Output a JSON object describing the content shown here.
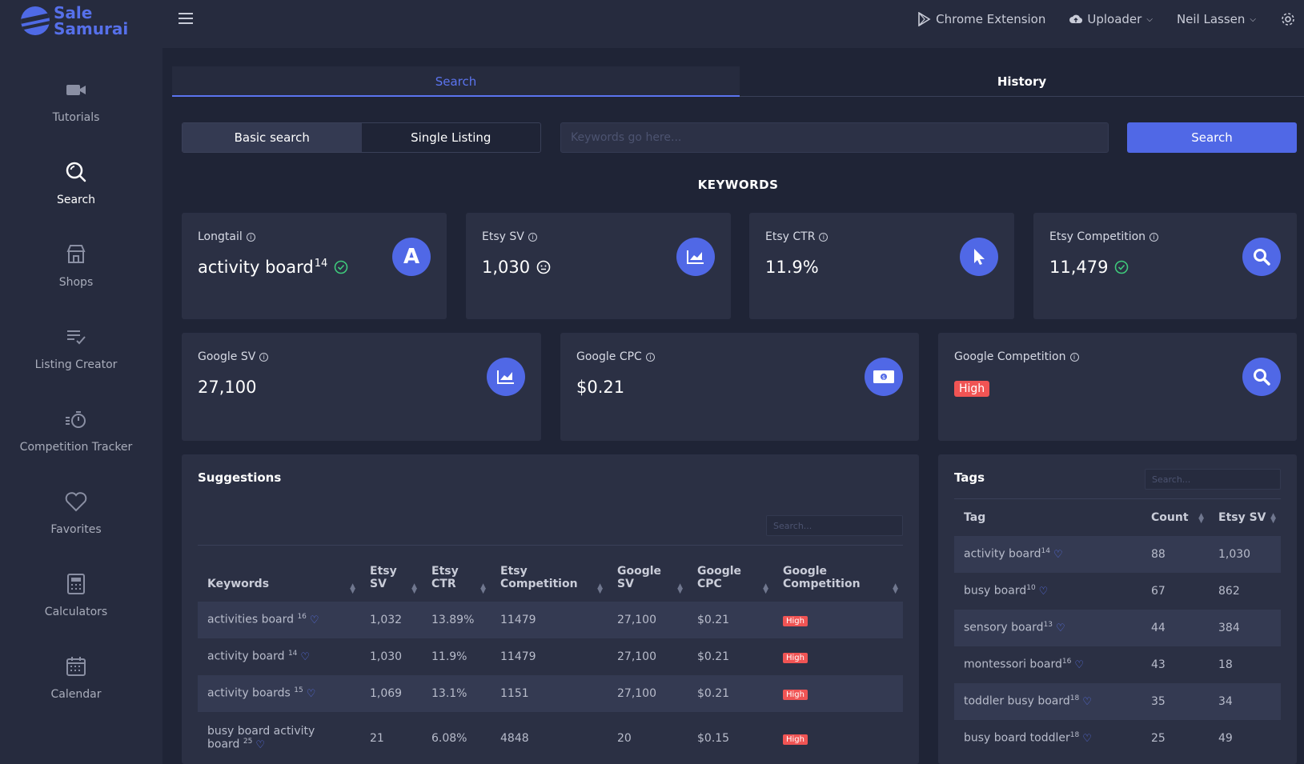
{
  "brand": {
    "line1": "Sale",
    "line2": "Samurai"
  },
  "nav": [
    {
      "label": "Tutorials",
      "icon": "video-camera-icon"
    },
    {
      "label": "Search",
      "icon": "search-icon",
      "active": true
    },
    {
      "label": "Shops",
      "icon": "shop-icon"
    },
    {
      "label": "Listing Creator",
      "icon": "list-check-icon"
    },
    {
      "label": "Competition Tracker",
      "icon": "stopwatch-icon"
    },
    {
      "label": "Favorites",
      "icon": "heart-icon"
    },
    {
      "label": "Calculators",
      "icon": "calculator-icon"
    },
    {
      "label": "Calendar",
      "icon": "calendar-icon"
    }
  ],
  "topbar": {
    "chrome_extension": "Chrome Extension",
    "uploader": "Uploader",
    "user": "Neil Lassen"
  },
  "tabs": {
    "search": "Search",
    "history": "History"
  },
  "search_mode": {
    "basic": "Basic search",
    "single": "Single Listing"
  },
  "keyword_input": {
    "placeholder": "Keywords go here..."
  },
  "search_button": "Search",
  "section_title": "KEYWORDS",
  "cards": {
    "longtail": {
      "label": "Longtail",
      "value": "activity board",
      "sup": "14"
    },
    "etsy_sv": {
      "label": "Etsy SV",
      "value": "1,030"
    },
    "etsy_ctr": {
      "label": "Etsy CTR",
      "value": "11.9%"
    },
    "etsy_competition": {
      "label": "Etsy Competition",
      "value": "11,479"
    },
    "google_sv": {
      "label": "Google SV",
      "value": "27,100"
    },
    "google_cpc": {
      "label": "Google CPC",
      "value": "$0.21"
    },
    "google_competition": {
      "label": "Google Competition",
      "value": "High"
    }
  },
  "suggestions": {
    "title": "Suggestions",
    "search_placeholder": "Search...",
    "headers": {
      "keywords": "Keywords",
      "etsy_sv_1": "Etsy",
      "etsy_sv_2": "SV",
      "etsy_ctr_1": "Etsy",
      "etsy_ctr_2": "CTR",
      "etsy_comp_1": "Etsy",
      "etsy_comp_2": "Competition",
      "google_sv_1": "Google",
      "google_sv_2": "SV",
      "google_cpc_1": "Google",
      "google_cpc_2": "CPC",
      "google_comp_1": "Google",
      "google_comp_2": "Competition"
    },
    "rows": [
      {
        "kw": "activities board",
        "sup": "16",
        "etsy_sv": "1,032",
        "etsy_ctr": "13.89%",
        "etsy_comp": "11479",
        "google_sv": "27,100",
        "google_cpc": "$0.21",
        "google_comp": "High"
      },
      {
        "kw": "activity board",
        "sup": "14",
        "etsy_sv": "1,030",
        "etsy_ctr": "11.9%",
        "etsy_comp": "11479",
        "google_sv": "27,100",
        "google_cpc": "$0.21",
        "google_comp": "High"
      },
      {
        "kw": "activity boards",
        "sup": "15",
        "etsy_sv": "1,069",
        "etsy_ctr": "13.1%",
        "etsy_comp": "1151",
        "google_sv": "27,100",
        "google_cpc": "$0.21",
        "google_comp": "High"
      },
      {
        "kw": "busy board activity",
        "kw2": "board",
        "sup": "25",
        "etsy_sv": "21",
        "etsy_ctr": "6.08%",
        "etsy_comp": "4848",
        "google_sv": "20",
        "google_cpc": "$0.15",
        "google_comp": "High"
      }
    ]
  },
  "tags": {
    "title": "Tags",
    "search_placeholder": "Search...",
    "headers": {
      "tag": "Tag",
      "count": "Count",
      "etsy_sv": "Etsy SV"
    },
    "rows": [
      {
        "tag": "activity board",
        "sup": "14",
        "count": "88",
        "etsy_sv": "1,030"
      },
      {
        "tag": "busy board",
        "sup": "10",
        "count": "67",
        "etsy_sv": "862"
      },
      {
        "tag": "sensory board",
        "sup": "13",
        "count": "44",
        "etsy_sv": "384"
      },
      {
        "tag": "montessori board",
        "sup": "16",
        "count": "43",
        "etsy_sv": "18"
      },
      {
        "tag": "toddler busy board",
        "sup": "18",
        "count": "35",
        "etsy_sv": "34"
      },
      {
        "tag": "busy board toddler",
        "sup": "18",
        "count": "25",
        "etsy_sv": "49"
      }
    ]
  },
  "colors": {
    "accent": "#5068e6",
    "danger": "#f05454",
    "success": "#3ec97b"
  }
}
